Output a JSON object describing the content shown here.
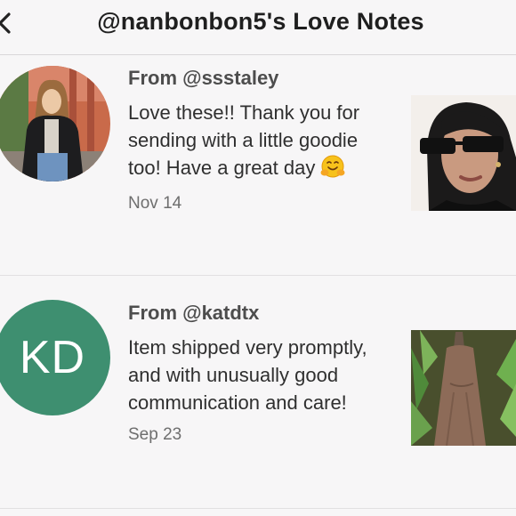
{
  "header": {
    "title": "@nanbonbon5's Love Notes",
    "back_icon": "chevron-left-icon"
  },
  "notes": [
    {
      "from": "From @ssstaley",
      "message": "Love these!! Thank you for sending with a little goodie too! Have a great day",
      "emoji": "hugging-face-emoji",
      "date": "Nov 14",
      "avatar_type": "photo"
    },
    {
      "from": "From @katdtx",
      "avatar_initials": "KD",
      "avatar_color": "#3e8f70",
      "message": "Item shipped very promptly, and with unusually good communication and care!",
      "date": "Sep 23",
      "avatar_type": "initials"
    }
  ]
}
